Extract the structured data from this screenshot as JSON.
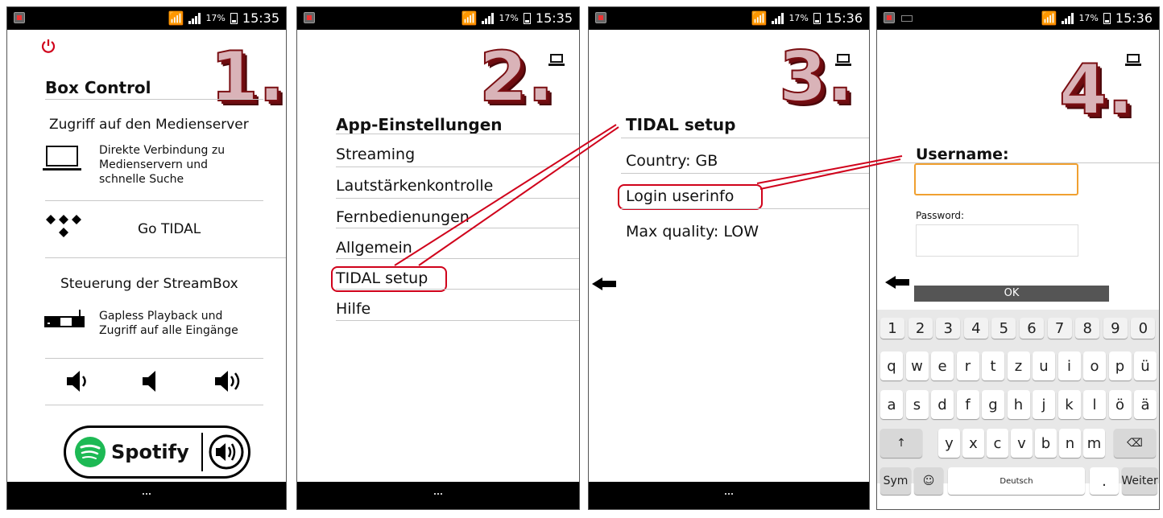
{
  "status_bar": {
    "battery": "17%",
    "times": [
      "15:35",
      "15:35",
      "15:36",
      "15:36"
    ]
  },
  "steps": [
    "1.",
    "2.",
    "3.",
    "4."
  ],
  "panel1": {
    "title": "Box Control",
    "media_server_heading": "Zugriff auf den Medienserver",
    "media_server_desc": [
      "Direkte Verbindung zu",
      "Medienservern und",
      "schnelle Suche"
    ],
    "go_tidal_label": "Go TIDAL",
    "streambox_heading": "Steuerung der StreamBox",
    "streambox_desc": [
      "Gapless Playback und",
      "Zugriff auf alle Eingänge"
    ],
    "spotify_label": "Spotify"
  },
  "panel2": {
    "title": "App-Einstellungen",
    "menu": [
      "Streaming",
      "Lautstärkenkontrolle",
      "Fernbedienungen",
      "Allgemein",
      "TIDAL setup",
      "Hilfe"
    ]
  },
  "panel3": {
    "title": "TIDAL setup",
    "items": [
      "Country: GB",
      "Login userinfo",
      "Max quality: LOW"
    ]
  },
  "panel4": {
    "username_label": "Username:",
    "username_value": "",
    "password_label": "Password:",
    "password_value": "",
    "ok_label": "OK"
  },
  "keyboard": {
    "numbers": [
      "1",
      "2",
      "3",
      "4",
      "5",
      "6",
      "7",
      "8",
      "9",
      "0"
    ],
    "row1": [
      "q",
      "w",
      "e",
      "r",
      "t",
      "z",
      "u",
      "i",
      "o",
      "p",
      "ü"
    ],
    "row2": [
      "a",
      "s",
      "d",
      "f",
      "g",
      "h",
      "j",
      "k",
      "l",
      "ö",
      "ä"
    ],
    "row3": [
      "y",
      "x",
      "c",
      "v",
      "b",
      "n",
      "m"
    ],
    "sym_label": "Sym",
    "space_label": "Deutsch",
    "period_label": ".",
    "next_label": "Weiter"
  },
  "colors": {
    "accent_red": "#d0021b",
    "input_focus": "#f0a030",
    "tidal": "#000000",
    "spotify_green": "#1db954"
  }
}
